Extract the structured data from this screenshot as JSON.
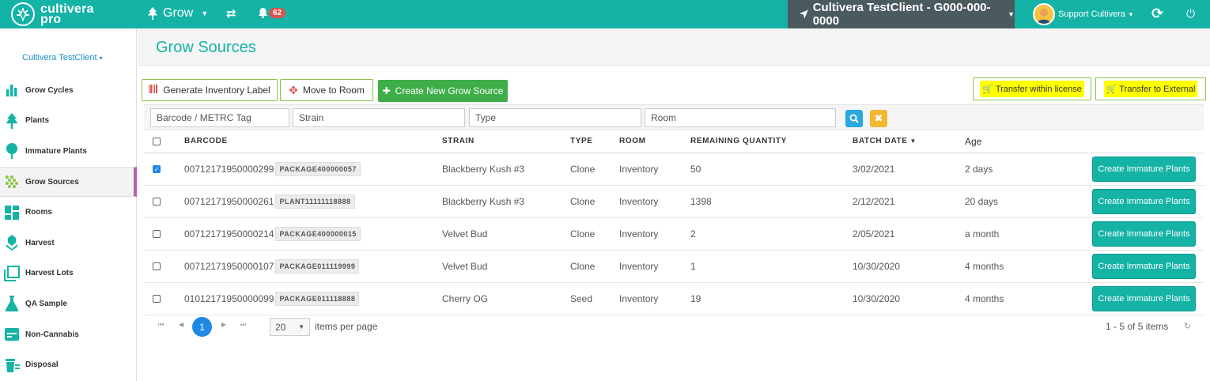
{
  "topbar": {
    "logo_line1": "cultivera",
    "logo_line2": "pro",
    "module": "Grow",
    "notification_count": "62",
    "client": "Cultivera TestClient - G000-000-0000",
    "user": "Support Cultivera"
  },
  "sidebar": {
    "client_name": "Cultivera TestClient",
    "items": [
      {
        "label": "Grow Cycles",
        "icon": "bar-chart-icon"
      },
      {
        "label": "Plants",
        "icon": "tree-icon"
      },
      {
        "label": "Immature Plants",
        "icon": "sapling-icon"
      },
      {
        "label": "Grow Sources",
        "icon": "seeds-icon"
      },
      {
        "label": "Rooms",
        "icon": "grid-icon"
      },
      {
        "label": "Harvest",
        "icon": "harvest-icon"
      },
      {
        "label": "Harvest Lots",
        "icon": "lots-icon"
      },
      {
        "label": "QA Sample",
        "icon": "flask-icon"
      },
      {
        "label": "Non-Cannabis",
        "icon": "box-icon"
      },
      {
        "label": "Disposal",
        "icon": "trash-icon"
      }
    ]
  },
  "page": {
    "title": "Grow Sources"
  },
  "toolbar": {
    "generate_label": "Generate Inventory Label",
    "move_label": "Move to Room",
    "create_label": "Create New Grow Source",
    "transfer_within": "Transfer within license",
    "transfer_external": "Transfer to External"
  },
  "filters": {
    "barcode_placeholder": "Barcode / METRC Tag",
    "strain_placeholder": "Strain",
    "type_placeholder": "Type",
    "room_placeholder": "Room"
  },
  "table": {
    "headers": {
      "barcode": "BARCODE",
      "strain": "STRAIN",
      "type": "TYPE",
      "room": "ROOM",
      "remaining": "REMAINING QUANTITY",
      "batch_date": "BATCH DATE",
      "age": "Age"
    },
    "action_label": "Create Immature Plants",
    "rows": [
      {
        "checked": true,
        "barcode": "00712171950000299",
        "tag": "PACKAGE400000057",
        "strain": "Blackberry Kush #3",
        "type": "Clone",
        "room": "Inventory",
        "remaining": "50",
        "batch_date": "3/02/2021",
        "age": "2 days"
      },
      {
        "checked": false,
        "barcode": "00712171950000261",
        "tag": "PLANT11111118888",
        "strain": "Blackberry Kush #3",
        "type": "Clone",
        "room": "Inventory",
        "remaining": "1398",
        "batch_date": "2/12/2021",
        "age": "20 days"
      },
      {
        "checked": false,
        "barcode": "00712171950000214",
        "tag": "PACKAGE400000015",
        "strain": "Velvet Bud",
        "type": "Clone",
        "room": "Inventory",
        "remaining": "2",
        "batch_date": "2/05/2021",
        "age": "a month"
      },
      {
        "checked": false,
        "barcode": "00712171950000107",
        "tag": "PACKAGE011119999",
        "strain": "Velvet Bud",
        "type": "Clone",
        "room": "Inventory",
        "remaining": "1",
        "batch_date": "10/30/2020",
        "age": "4 months"
      },
      {
        "checked": false,
        "barcode": "01012171950000099",
        "tag": "PACKAGE011118888",
        "strain": "Cherry OG",
        "type": "Seed",
        "room": "Inventory",
        "remaining": "19",
        "batch_date": "10/30/2020",
        "age": "4 months"
      }
    ]
  },
  "pager": {
    "current_page": "1",
    "page_size": "20",
    "items_label": "items per page",
    "info": "1 - 5 of 5 items"
  }
}
